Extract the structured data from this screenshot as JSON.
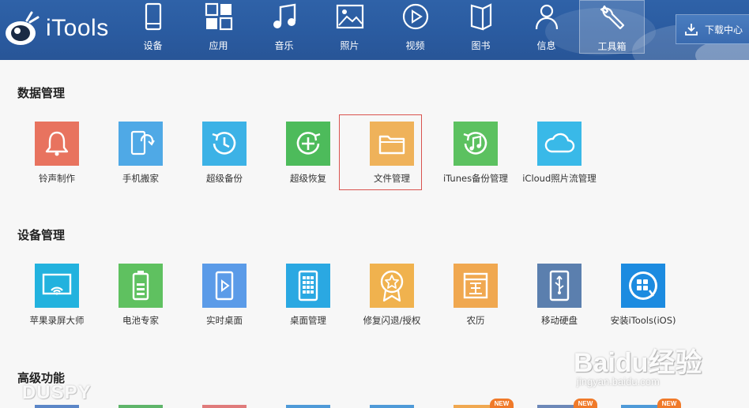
{
  "app": {
    "name": "iTools"
  },
  "nav": [
    {
      "id": "device",
      "label": "设备",
      "icon": "phone-icon"
    },
    {
      "id": "apps",
      "label": "应用",
      "icon": "apps-grid-icon"
    },
    {
      "id": "music",
      "label": "音乐",
      "icon": "music-note-icon"
    },
    {
      "id": "photos",
      "label": "照片",
      "icon": "photo-icon"
    },
    {
      "id": "video",
      "label": "视频",
      "icon": "play-circle-icon"
    },
    {
      "id": "books",
      "label": "图书",
      "icon": "book-icon"
    },
    {
      "id": "messages",
      "label": "信息",
      "icon": "person-icon"
    },
    {
      "id": "toolbox",
      "label": "工具箱",
      "icon": "wrench-icon",
      "active": true
    }
  ],
  "download_center": {
    "label": "下载中心",
    "icon": "download-icon"
  },
  "sections": {
    "data_management": {
      "title": "数据管理",
      "tools": [
        {
          "label": "铃声制作",
          "icon": "bell-icon",
          "color": "#e8735f"
        },
        {
          "label": "手机搬家",
          "icon": "phone-transfer-icon",
          "color": "#4fa9e6"
        },
        {
          "label": "超级备份",
          "icon": "clock-backup-icon",
          "color": "#3cb2e6"
        },
        {
          "label": "超级恢复",
          "icon": "plus-restore-icon",
          "color": "#4dbb5b"
        },
        {
          "label": "文件管理",
          "icon": "folder-icon",
          "color": "#efb25a",
          "selected": true
        },
        {
          "label": "iTunes备份管理",
          "icon": "music-backup-icon",
          "color": "#5cc160"
        },
        {
          "label": "iCloud照片流管理",
          "icon": "cloud-icon",
          "color": "#39b9e8"
        }
      ]
    },
    "device_management": {
      "title": "设备管理",
      "tools": [
        {
          "label": "苹果录屏大师",
          "icon": "screen-mirror-icon",
          "color": "#22b2de"
        },
        {
          "label": "电池专家",
          "icon": "battery-icon",
          "color": "#5fc160"
        },
        {
          "label": "实时桌面",
          "icon": "realtime-desktop-icon",
          "color": "#5b9be8"
        },
        {
          "label": "桌面管理",
          "icon": "desktop-grid-icon",
          "color": "#2aa8e2"
        },
        {
          "label": "修复闪退/授权",
          "icon": "badge-star-icon",
          "color": "#f0b24e"
        },
        {
          "label": "农历",
          "icon": "calendar-icon",
          "color": "#f0a850"
        },
        {
          "label": "移动硬盘",
          "icon": "usb-drive-icon",
          "color": "#5b7fae"
        },
        {
          "label": "安装iTools(iOS)",
          "icon": "itools-app-icon",
          "color": "#1c8be0"
        }
      ]
    },
    "advanced": {
      "title": "高级功能",
      "partial_tile_colors": [
        "#5b86c7",
        "#5fb56a",
        "#e07b7b",
        "#4f9ad8",
        "#4f9ad8",
        "#f0a850",
        "#6d88b8",
        "#4f9ad8"
      ],
      "new_badge": "NEW"
    }
  },
  "watermarks": {
    "left": "DUSPY",
    "baidu_logo": "Baidu经验",
    "baidu_url": "jingyan.baidu.com"
  }
}
